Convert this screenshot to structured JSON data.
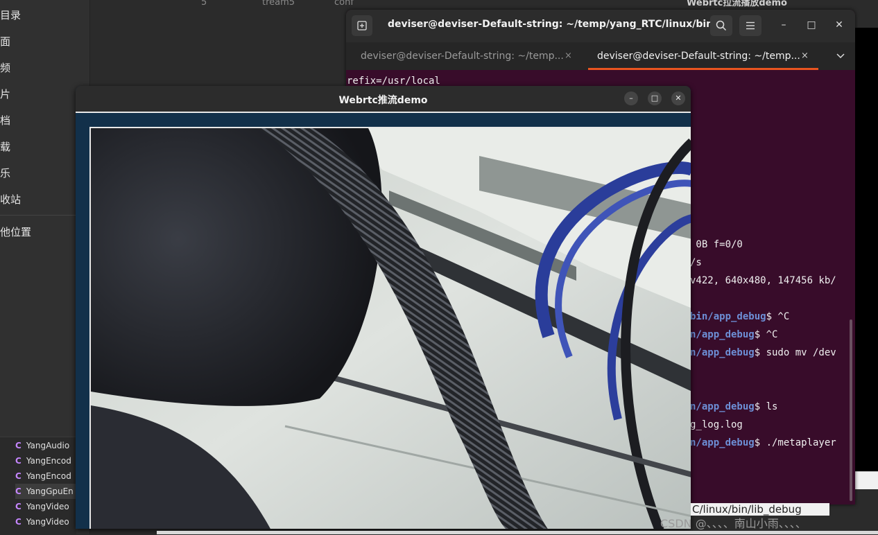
{
  "sidebar": {
    "items": [
      {
        "label": "目录"
      },
      {
        "label": "面"
      },
      {
        "label": "频"
      },
      {
        "label": "片"
      },
      {
        "label": "档"
      },
      {
        "label": "载"
      },
      {
        "label": "乐"
      },
      {
        "label": "收站"
      },
      {
        "label": "他位置"
      }
    ]
  },
  "background": {
    "col_number": "5",
    "col_name": "tream5",
    "col_extra": "conf",
    "behind_window_title": "Webrtc拉流播放demo"
  },
  "file_list": {
    "files": [
      {
        "icon": "C",
        "name": "YangAudio"
      },
      {
        "icon": "C",
        "name": "YangEncod"
      },
      {
        "icon": "C",
        "name": "YangEncod"
      },
      {
        "icon": "C",
        "name": "YangGpuEn"
      },
      {
        "icon": "C",
        "name": "YangVideo"
      },
      {
        "icon": "C",
        "name": "YangVideo"
      }
    ]
  },
  "terminal": {
    "title": "deviser@deviser-Default-string: ~/temp/yang_RTC/linux/bin...",
    "tabs": [
      {
        "label": "deviser@deviser-Default-string: ~/temp...",
        "active": false
      },
      {
        "label": "deviser@deviser-Default-string: ~/temp...",
        "active": true
      }
    ],
    "tab_close": "×",
    "lines": {
      "l1": "refix=/usr/local",
      "l2": " 0B f=0/0",
      "l3": "/s",
      "l4": "v422, 640x480, 147456 kb/",
      "l5_path": "bin/app_debug",
      "l5_cmd": "$ ^C",
      "l6_path": "n/app_debug",
      "l6_cmd": "$ ^C",
      "l7_path": "n/app_debug",
      "l7_cmd": "$ sudo mv /dev",
      "l8_path": "n/app_debug",
      "l8_cmd": "$ ls",
      "l9": "g_log.log",
      "l10_path": "n/app_debug",
      "l10_cmd": "$ ./metaplayer"
    },
    "accent_color": "#e95420",
    "background_color": "#380c2a"
  },
  "demo_window": {
    "title": "Webrtc推流demo",
    "minimize": "–",
    "maximize": "□",
    "close": "✕"
  },
  "footer": {
    "path_text": "C/linux/bin/lib_debug",
    "watermark": "CSDN @、、、、南山小雨、、、、"
  }
}
